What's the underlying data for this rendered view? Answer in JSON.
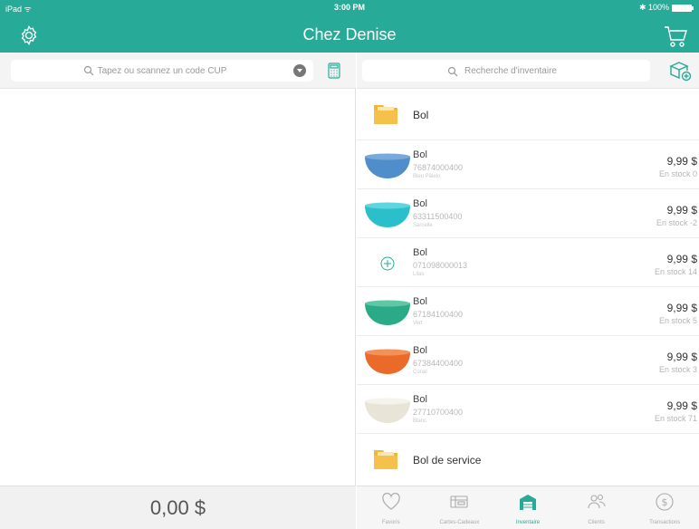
{
  "status_bar": {
    "carrier": "iPad ᯤ",
    "time": "3:00 PM",
    "battery": "✱ 100%"
  },
  "header": {
    "title": "Chez Denise"
  },
  "left_pane": {
    "scan_placeholder": "Tapez ou scannez un code CUP",
    "total": "0,00 $"
  },
  "right_pane": {
    "search_placeholder": "Recherche d'inventaire",
    "items": [
      {
        "type": "folder",
        "name": "Bol"
      },
      {
        "type": "product",
        "name": "Bol",
        "sku": "76874000400",
        "vendor": "Bleu Pâlelo",
        "price": "9,99 $",
        "stock": "En stock 0",
        "color": "#4f8ecb"
      },
      {
        "type": "product",
        "name": "Bol",
        "sku": "63311500400",
        "vendor": "Sarcelle",
        "price": "9,99 $",
        "stock": "En stock -2",
        "color": "#2bbfcc"
      },
      {
        "type": "product",
        "name": "Bol",
        "sku": "071098000013",
        "vendor": "Lilas",
        "price": "9,99 $",
        "stock": "En stock 14",
        "color": ""
      },
      {
        "type": "product",
        "name": "Bol",
        "sku": "67184100400",
        "vendor": "Vert",
        "price": "9,99 $",
        "stock": "En stock 5",
        "color": "#2aaa86"
      },
      {
        "type": "product",
        "name": "Bol",
        "sku": "67384400400",
        "vendor": "Corail",
        "price": "9,99 $",
        "stock": "En stock 3",
        "color": "#ea6a2a"
      },
      {
        "type": "product",
        "name": "Bol",
        "sku": "27710700400",
        "vendor": "Blanc",
        "price": "9,99 $",
        "stock": "En stock 71",
        "color": "#f1eee6"
      },
      {
        "type": "folder",
        "name": "Bol de service"
      }
    ]
  },
  "tabs": [
    {
      "label": "Favoris",
      "icon": "heart-icon"
    },
    {
      "label": "Cartes-Cadeaux",
      "icon": "gift-card-icon"
    },
    {
      "label": "Inventaire",
      "icon": "warehouse-icon",
      "active": true
    },
    {
      "label": "Clients",
      "icon": "clients-icon"
    },
    {
      "label": "Transactions",
      "icon": "dollar-coin-icon"
    }
  ],
  "colors": {
    "accent": "#27aa98",
    "folder": "#f2b733"
  }
}
